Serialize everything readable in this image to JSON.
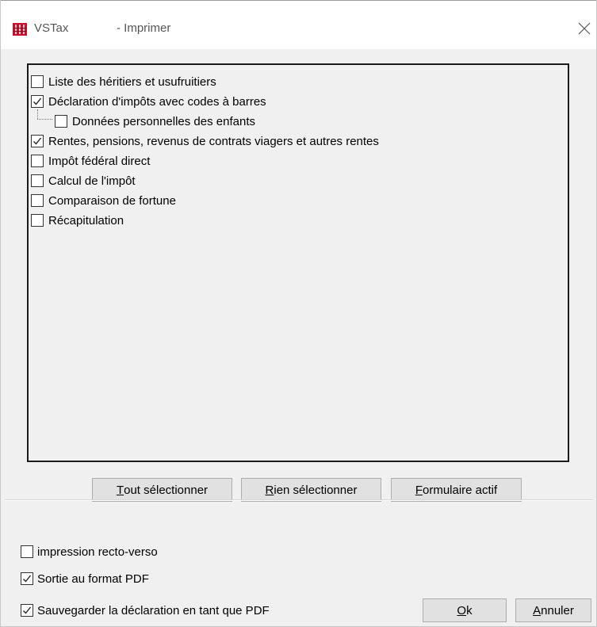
{
  "window": {
    "app_name": "VSTax",
    "title": "- Imprimer"
  },
  "print_items": [
    {
      "label": "Liste des héritiers et usufruitiers",
      "checked": false,
      "level": 0
    },
    {
      "label": "Déclaration d'impôts avec codes à barres",
      "checked": true,
      "level": 0
    },
    {
      "label": "Données personnelles des enfants",
      "checked": false,
      "level": 1
    },
    {
      "label": "Rentes, pensions, revenus de contrats viagers et autres rentes",
      "checked": true,
      "level": 0
    },
    {
      "label": "Impôt fédéral direct",
      "checked": false,
      "level": 0
    },
    {
      "label": "Calcul de l'impôt",
      "checked": false,
      "level": 0
    },
    {
      "label": "Comparaison de fortune",
      "checked": false,
      "level": 0
    },
    {
      "label": "Récapitulation",
      "checked": false,
      "level": 0
    }
  ],
  "selection_buttons": {
    "select_all": {
      "mnemonic": "T",
      "rest": "out sélectionner"
    },
    "select_none": {
      "mnemonic": "R",
      "rest": "ien sélectionner"
    },
    "active_form": {
      "mnemonic": "F",
      "rest": "ormulaire actif"
    }
  },
  "options": [
    {
      "label": "impression recto-verso",
      "checked": false
    },
    {
      "label": "Sortie au format PDF",
      "checked": true
    },
    {
      "label": "Sauvegarder la déclaration en tant que PDF",
      "checked": true
    }
  ],
  "dialog_buttons": {
    "ok": {
      "mnemonic": "O",
      "rest": "k"
    },
    "cancel": {
      "mnemonic": "A",
      "rest": "nnuler"
    }
  },
  "colors": {
    "dialog_bg": "#f0f0f0",
    "titlebar_bg": "#ffffff",
    "icon_red": "#c8102e"
  },
  "icons": {
    "app": "vstax-app-icon",
    "close": "close-icon",
    "check": "checkmark-icon"
  }
}
